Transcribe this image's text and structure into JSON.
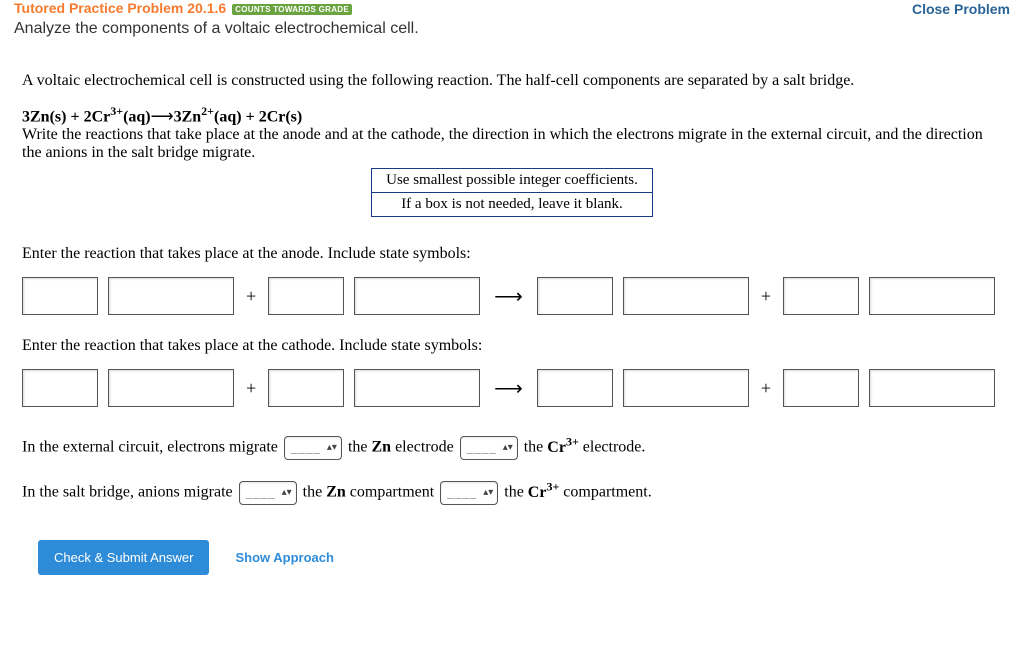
{
  "header": {
    "breadcrumb_prefix": "Tutored Practice Problem 20.1.6",
    "badge": "COUNTS TOWARDS GRADE",
    "close": "Close Problem",
    "subtitle": "Analyze the components of a voltaic electrochemical cell."
  },
  "intro": "A voltaic electrochemical cell is constructed using the following reaction. The half-cell components are separated by a salt bridge.",
  "equation": {
    "lhs1_coef": "3",
    "lhs1_species": "Zn(s)",
    "plus": " + ",
    "lhs2_coef": "2",
    "lhs2_species": "Cr",
    "lhs2_charge": "3+",
    "lhs2_state": "(aq)",
    "arrow": "⟶",
    "rhs1_coef": "3",
    "rhs1_species": "Zn",
    "rhs1_charge": "2+",
    "rhs1_state": "(aq)",
    "rhs2_coef": "2",
    "rhs2_species": "Cr(s)"
  },
  "instruction": "Write the reactions that take place at the anode and at the cathode, the direction in which the electrons migrate in the external circuit, and the direction the anions in the salt bridge migrate.",
  "hints": {
    "line1": "Use smallest possible integer coefficients.",
    "line2": "If a box is not needed, leave it blank."
  },
  "prompts": {
    "anode": "Enter the reaction that takes place at the anode. Include state symbols:",
    "cathode": "Enter the reaction that takes place at the cathode. Include state symbols:"
  },
  "fill": {
    "external_pre": "In the external circuit, electrons migrate ",
    "external_mid1": " the ",
    "zn_label": "Zn",
    "external_mid2": " electrode ",
    "external_mid3": " the ",
    "cr_label": "Cr",
    "cr_charge": "3+",
    "external_end": " electrode.",
    "salt_pre": "In the salt bridge, anions migrate ",
    "salt_mid1": " the ",
    "salt_mid2": " compartment ",
    "salt_mid3": " the ",
    "salt_end": " compartment."
  },
  "select_placeholder": "____",
  "buttons": {
    "submit": "Check & Submit Answer",
    "approach": "Show Approach"
  }
}
